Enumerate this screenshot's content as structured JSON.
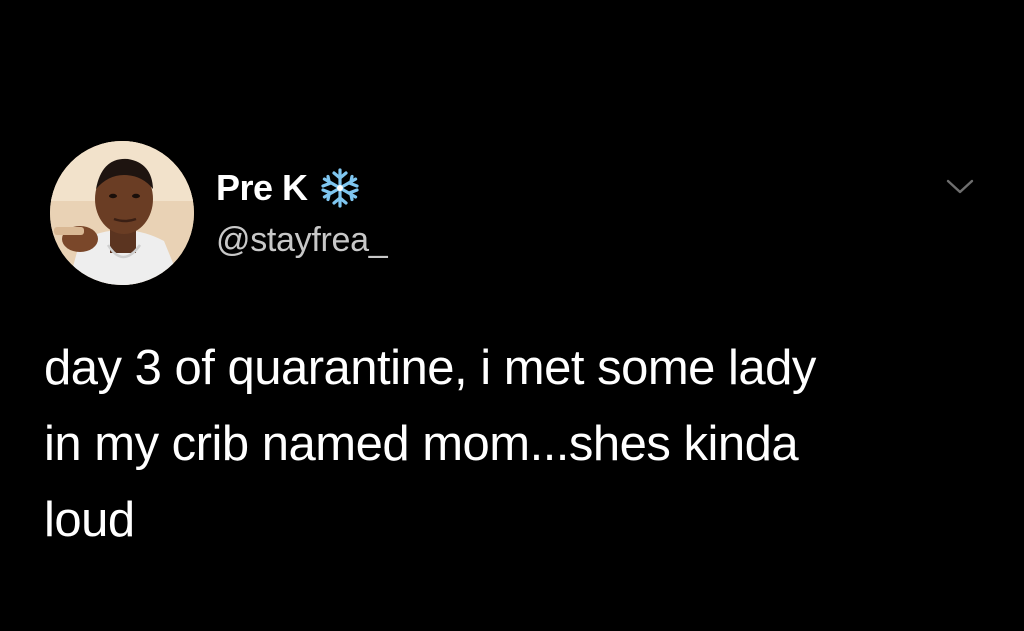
{
  "theme": {
    "background": "#000000",
    "text": "#ffffff",
    "secondary_text": "#c8c8c8",
    "icon_color": "#6e6e6e",
    "snowflake_color": "#7fc6f0"
  },
  "tweet": {
    "author": {
      "display_name": "Pre K",
      "badge_icon": "snowflake-emoji",
      "handle": "@stayfrea_",
      "avatar": "profile-photo"
    },
    "menu_icon": "chevron-down-icon",
    "text": "day 3 of quarantine, i met some lady\nin my crib named mom...shes kinda\nloud"
  }
}
